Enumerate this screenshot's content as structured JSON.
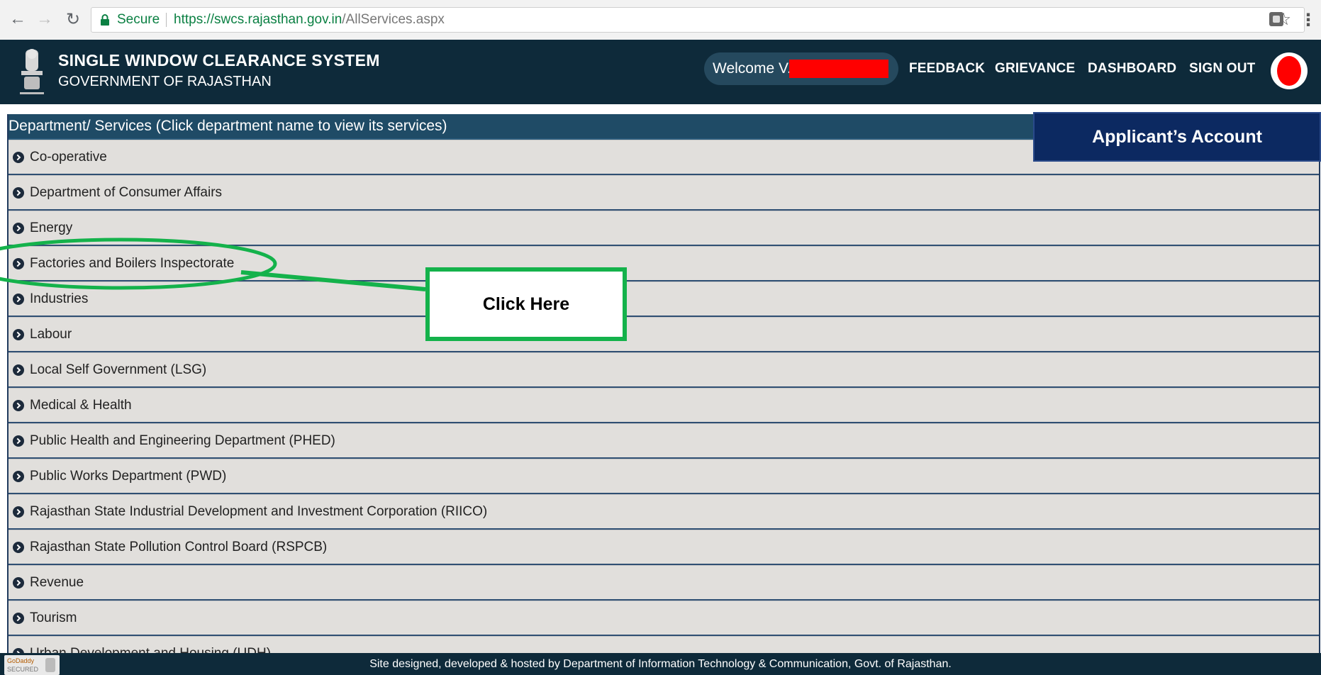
{
  "browser": {
    "secure_label": "Secure",
    "url_scheme_host": "https://swcs.rajasthan.gov.in",
    "url_path": "/AllServices.aspx"
  },
  "header": {
    "title": "SINGLE WINDOW CLEARANCE SYSTEM",
    "subtitle": "GOVERNMENT OF RAJASTHAN",
    "welcome": "Welcome V.",
    "nav": {
      "feedback": "FEEDBACK",
      "grievance": "GRIEVANCE",
      "dashboard": "DASHBOARD",
      "sign_out": "SIGN OUT"
    }
  },
  "list": {
    "heading": "Department/ Services (Click department name to view its services)",
    "items": [
      "Co-operative",
      "Department of Consumer Affairs",
      "Energy",
      "Factories and Boilers Inspectorate",
      "Industries",
      "Labour",
      "Local Self Government (LSG)",
      "Medical & Health",
      "Public Health and Engineering Department (PHED)",
      "Public Works Department (PWD)",
      "Rajasthan State Industrial Development and Investment Corporation (RIICO)",
      "Rajasthan State Pollution Control Board (RSPCB)",
      "Revenue",
      "Tourism",
      "Urban Development and Housing (UDH)"
    ]
  },
  "callouts": {
    "account": "Applicant’s Account",
    "click_here": "Click Here"
  },
  "footer": {
    "text": "Site designed, developed & hosted by Department of Information Technology & Communication, Govt. of Rajasthan.",
    "badge_line1": "GoDaddy",
    "badge_line2": "SECURED"
  },
  "colors": {
    "header_bg": "#0e2a3a",
    "list_head_bg": "#1f4b66",
    "row_bg": "#e1dfdc",
    "callout_green": "#14b24b",
    "account_bg": "#0c2961"
  }
}
